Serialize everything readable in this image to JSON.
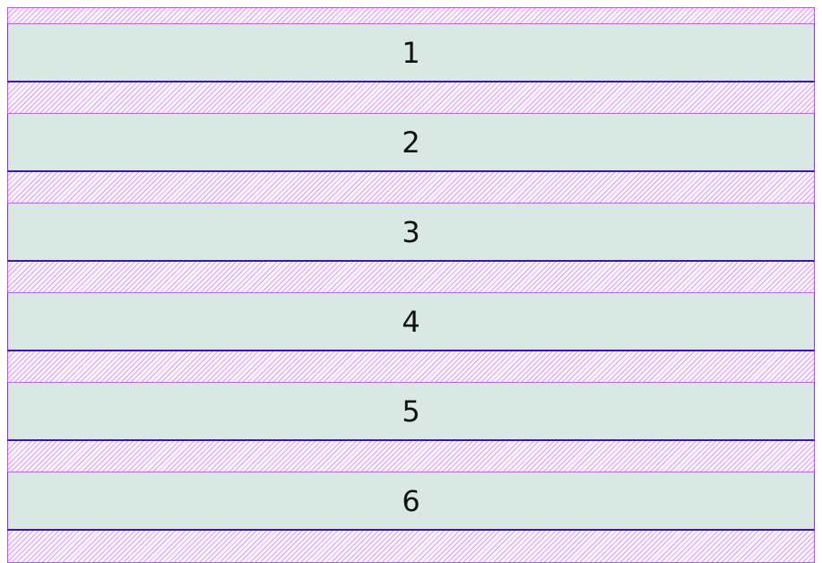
{
  "grid": {
    "items": [
      {
        "label": "1"
      },
      {
        "label": "2"
      },
      {
        "label": "3"
      },
      {
        "label": "4"
      },
      {
        "label": "5"
      },
      {
        "label": "6"
      }
    ]
  }
}
